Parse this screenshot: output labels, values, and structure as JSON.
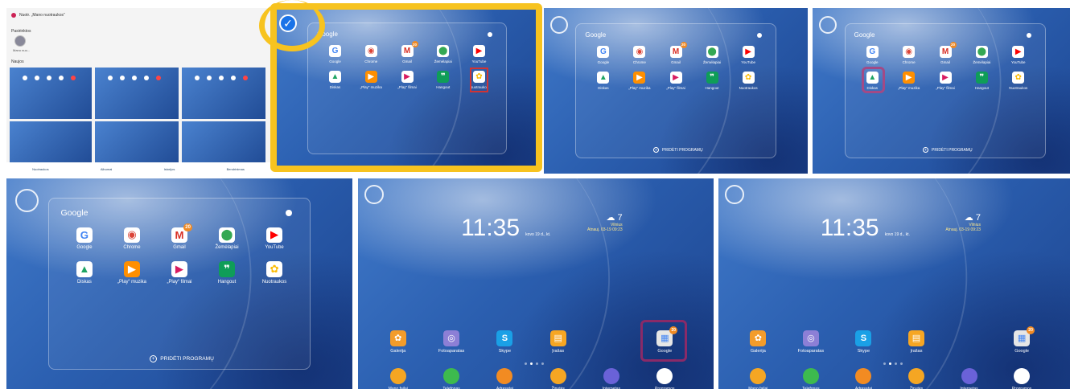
{
  "gallery": {
    "album_name": "Nuotr. „Mano nuotraukos“",
    "favorites_label": "Pasirinktos",
    "favorites_item": "Mano nuo...",
    "recent_label": "Naujos",
    "nav": [
      "Nuotraukos",
      "Albumai",
      "Istorijos",
      "Bendrinimas"
    ]
  },
  "folder": {
    "title": "Google",
    "add_programs": "PRIDĖTI PROGRAMŲ",
    "apps": [
      {
        "label": "Google",
        "icon": "google-icon",
        "glyph": "G",
        "bg": "#ffffff",
        "fg": "#4285f4"
      },
      {
        "label": "Chrome",
        "icon": "chrome-icon",
        "glyph": "◉",
        "bg": "#ffffff",
        "fg": "#db4437"
      },
      {
        "label": "Gmail",
        "icon": "gmail-icon",
        "glyph": "M",
        "bg": "#ffffff",
        "fg": "#d93025",
        "badge": "20"
      },
      {
        "label": "Žemėlapiai",
        "icon": "maps-icon",
        "glyph": "⬤",
        "bg": "#ffffff",
        "fg": "#34a853"
      },
      {
        "label": "YouTube",
        "icon": "youtube-icon",
        "glyph": "▶",
        "bg": "#ffffff",
        "fg": "#ff0000"
      },
      {
        "label": "Diskas",
        "icon": "drive-icon",
        "glyph": "▲",
        "bg": "#ffffff",
        "fg": "#1fa463"
      },
      {
        "label": "„Play“ muzika",
        "icon": "play-music-icon",
        "glyph": "▶",
        "bg": "#ff8f00",
        "fg": "#ffffff"
      },
      {
        "label": "„Play“ filmai",
        "icon": "play-movies-icon",
        "glyph": "▶",
        "bg": "#ffffff",
        "fg": "#d81b60"
      },
      {
        "label": "Hangout",
        "icon": "hangouts-icon",
        "glyph": "❞",
        "bg": "#0f9d58",
        "fg": "#ffffff"
      },
      {
        "label": "Nuotraukos",
        "icon": "photos-icon",
        "glyph": "✿",
        "bg": "#ffffff",
        "fg": "#fbbc05"
      }
    ]
  },
  "home": {
    "time": "11:35",
    "date": "kovo 19 d., kt.",
    "temp": "7",
    "city": "Vilnius",
    "updated": "Atnauj. 03-19 09:23",
    "apps": [
      {
        "label": "Galerija",
        "icon": "gallery-icon",
        "glyph": "✿",
        "bg": "#f39c2b"
      },
      {
        "label": "Fotoaparatas",
        "icon": "camera-icon",
        "glyph": "◎",
        "bg": "#8c7fd6"
      },
      {
        "label": "Skype",
        "icon": "skype-icon",
        "glyph": "S",
        "bg": "#1aa0e6"
      },
      {
        "label": "Įrašas",
        "icon": "notes-icon",
        "glyph": "▤",
        "bg": "#f6a623"
      },
      {
        "label": "Google",
        "icon": "google-folder-icon",
        "glyph": "▦",
        "bg": "#e6e6e6",
        "badge": "20"
      }
    ],
    "dock": [
      {
        "label": "Mano failai",
        "icon": "my-files-icon",
        "bg": "#f5a623"
      },
      {
        "label": "Telefonas",
        "icon": "phone-icon",
        "bg": "#3dba4e"
      },
      {
        "label": "Adresatai",
        "icon": "contacts-icon",
        "bg": "#f28b22"
      },
      {
        "label": "Žinutės",
        "icon": "messages-icon",
        "bg": "#f5a623"
      },
      {
        "label": "Internetas",
        "icon": "internet-icon",
        "bg": "#6a62d8"
      },
      {
        "label": "Programos",
        "icon": "apps-grid-icon",
        "bg": "#ffffff"
      }
    ]
  },
  "colors": {
    "highlight_yellow": "#f7c31f",
    "check_blue": "#1a73e8",
    "annotation_red": "#d03434",
    "annotation_purple": "#8a2a68"
  }
}
